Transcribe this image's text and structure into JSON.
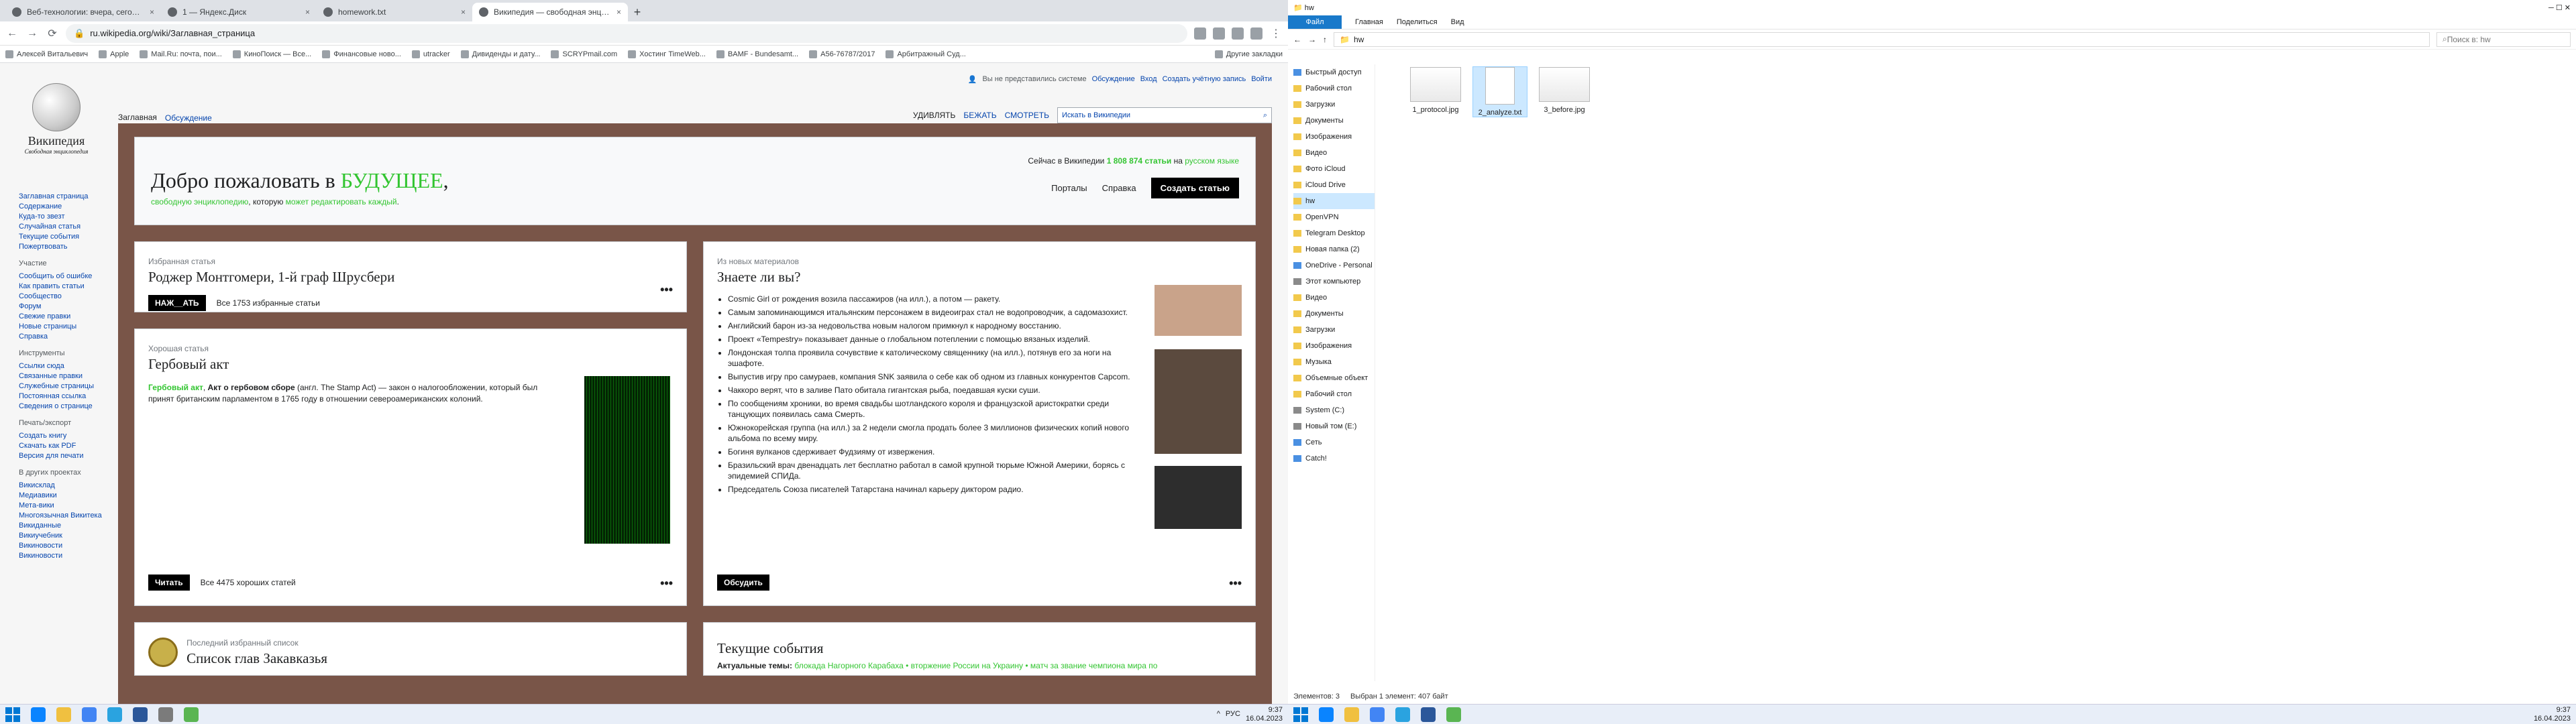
{
  "browser": {
    "tabs": [
      {
        "label": "Веб-технологии: вчера, сегодн..."
      },
      {
        "label": "1 — Яндекс.Диск"
      },
      {
        "label": "homework.txt"
      },
      {
        "label": "Википедия — свободная энцик..."
      }
    ],
    "new_tab": "+",
    "url": "ru.wikipedia.org/wiki/Заглавная_страница",
    "bookmarks": [
      "Алексей Витальевич",
      "Apple",
      "Mail.Ru: почта, пои...",
      "КиноПоиск — Все...",
      "Финансовые ново...",
      "utracker",
      "Дивиденды и дату...",
      "SCRYPmail.com",
      "Хостинг TimeWeb...",
      "BAMF - Bundesamt...",
      "A56-76787/2017",
      "Арбитражный Суд...",
      "Другие закладки"
    ]
  },
  "wiki": {
    "logo_title": "Википедия",
    "logo_sub": "Свободная энциклопедия",
    "top_links": [
      "Вы не представились системе",
      "Обсуждение",
      "Вход",
      "Создать учётную запись",
      "Войти"
    ],
    "tabs_left": [
      "Заглавная",
      "Обсуждение"
    ],
    "tabs_right": [
      "УДИВЛЯТЬ",
      "БЕЖАТЬ",
      "СМОТРЕТЬ"
    ],
    "search_placeholder": "Искать в Википедии",
    "sidebar_main": [
      "Заглавная страница",
      "Содержание",
      "Куда-то звезт",
      "Случайная статья",
      "Текущие события",
      "Пожертвовать"
    ],
    "sidebar_h1": "Участие",
    "sidebar_part": [
      "Сообщить об ошибке",
      "Как править статьи",
      "Сообщество",
      "Форум",
      "Свежие правки",
      "Новые страницы",
      "Справка"
    ],
    "sidebar_h2": "Инструменты",
    "sidebar_tools": [
      "Ссылки сюда",
      "Связанные правки",
      "Служебные страницы",
      "Постоянная ссылка",
      "Сведения о странице"
    ],
    "sidebar_h3": "Печать/экспорт",
    "sidebar_print": [
      "Создать книгу",
      "Скачать как PDF",
      "Версия для печати"
    ],
    "sidebar_h4": "В других проектах",
    "sidebar_proj": [
      "Викисклад",
      "Медиавики",
      "Мета-вики",
      "Многоязычная Викитека",
      "Викиданные",
      "Викиучебник",
      "Викиновости",
      "Викиновости"
    ],
    "hero": {
      "title_a": "Добро пожаловать в ",
      "title_b": "БУДУЩЕЕ",
      "title_c": ",",
      "sub_a": "свободную энциклопедию",
      "sub_b": ", которую ",
      "sub_c": "может редактировать каждый",
      "sub_d": ".",
      "now_a": "Сейчас в Википедии ",
      "now_n": "1 808 874 статьи",
      "now_b": " на ",
      "now_c": "русском языке",
      "btn1": "Порталы",
      "btn2": "Справка",
      "btn3": "Создать статью"
    },
    "featured": {
      "lab": "Избранная статья",
      "title": "Роджер Монтгомери, 1-й граф Шрусбери",
      "btn": "НАЖ__АТЬ",
      "count": "Все 1753 избранные статьи",
      "dots": "•••"
    },
    "good": {
      "lab": "Хорошая статья",
      "title": "Гербовый акт",
      "p_a": "Гербовый акт",
      "p_b": ", ",
      "p_c": "Акт о гербовом сборе",
      "p_d": " (англ. The Stamp Act) — закон о налогообложении, который был принят британским парламентом в 1765 году в отношении североамериканских колоний.",
      "btn": "Читать",
      "count": "Все 4475 хороших статей",
      "dots": "•••"
    },
    "list": {
      "lab": "Последний избранный список",
      "title": "Список глав Закавказья"
    },
    "dyk": {
      "lab": "Из новых материалов",
      "title": "Знаете ли вы?",
      "items": [
        "Cosmic Girl от рождения возила пассажиров (на илл.), а потом — ракету.",
        "Самым запоминающимся итальянским персонажем в видеоиграх стал не водопроводчик, а садомазохист.",
        "Английский барон из-за недовольства новым налогом примкнул к народному восстанию.",
        "Проект «Tempestry» показывает данные о глобальном потеплении с помощью вязаных изделий.",
        "Лондонская толпа проявила сочувствие к католическому священнику (на илл.), потянув его за ноги на эшафоте.",
        "Выпустив игру про самураев, компания SNK заявила о себе как об одном из главных конкурентов Capcom.",
        "Чаккорo верят, что в заливе Пато обитала гигантская рыба, поедавшая куски суши.",
        "По сообщениям хроники, во время свадьбы шотландского короля и французской аристократки среди танцующих появилась сама Смерть.",
        "Южнокорейская группа (на илл.) за 2 недели смогла продать более 3 миллионов физических копий нового альбома по всему миру.",
        "Богиня вулканов сдерживает Фудзияму от извержения.",
        "Бразильский врач двенадцать лет бесплатно работал в самой крупной тюрьме Южной Америки, борясь с эпидемией СПИДа.",
        "Председатель Союза писателей Татарстана начинал карьеру диктором радио."
      ],
      "btn": "Обсудить",
      "dots": "•••"
    },
    "news": {
      "title": "Текущие события",
      "line_a": "Актуальные темы: ",
      "line_b": "блокада Нагорного Карабаха • вторжение России на Украину • матч за звание чемпиона мира по"
    }
  },
  "explorer": {
    "title_path": "hw",
    "ribbon": [
      "Файл",
      "Главная",
      "Поделиться",
      "Вид"
    ],
    "path": "hw",
    "search": "Поиск в: hw",
    "sidebar": [
      {
        "label": "Быстрый доступ",
        "icon": "star-icon"
      },
      {
        "label": "Рабочий стол",
        "icon": "folder-icon"
      },
      {
        "label": "Загрузки",
        "icon": "folder-icon"
      },
      {
        "label": "Документы",
        "icon": "folder-icon"
      },
      {
        "label": "Изображения",
        "icon": "folder-icon"
      },
      {
        "label": "Видео",
        "icon": "folder-icon"
      },
      {
        "label": "Фото iCloud",
        "icon": "folder-icon"
      },
      {
        "label": "iCloud Drive",
        "icon": "folder-icon"
      },
      {
        "label": "hw",
        "icon": "folder-icon"
      },
      {
        "label": "OpenVPN",
        "icon": "folder-icon"
      },
      {
        "label": "Telegram Desktop",
        "icon": "folder-icon"
      },
      {
        "label": "Новая папка (2)",
        "icon": "folder-icon"
      },
      {
        "label": "OneDrive - Personal",
        "icon": "cloud-icon"
      },
      {
        "label": "Этот компьютер",
        "icon": "pc-icon"
      },
      {
        "label": "Видео",
        "icon": "folder-icon"
      },
      {
        "label": "Документы",
        "icon": "folder-icon"
      },
      {
        "label": "Загрузки",
        "icon": "folder-icon"
      },
      {
        "label": "Изображения",
        "icon": "folder-icon"
      },
      {
        "label": "Музыка",
        "icon": "folder-icon"
      },
      {
        "label": "Объемные объект",
        "icon": "folder-icon"
      },
      {
        "label": "Рабочий стол",
        "icon": "folder-icon"
      },
      {
        "label": "System (C:)",
        "icon": "drive-icon"
      },
      {
        "label": "Новый том (E:)",
        "icon": "drive-icon"
      },
      {
        "label": "Сеть",
        "icon": "network-icon"
      },
      {
        "label": "Catch!",
        "icon": "network-icon"
      }
    ],
    "files": [
      "1_protocol.jpg",
      "2_analyze.txt",
      "3_before.jpg"
    ],
    "status_a": "Элементов: 3",
    "status_b": "Выбран 1 элемент: 407 байт"
  },
  "taskbar": {
    "lang": "РУС",
    "time": "9:37",
    "date": "16.04.2023"
  }
}
